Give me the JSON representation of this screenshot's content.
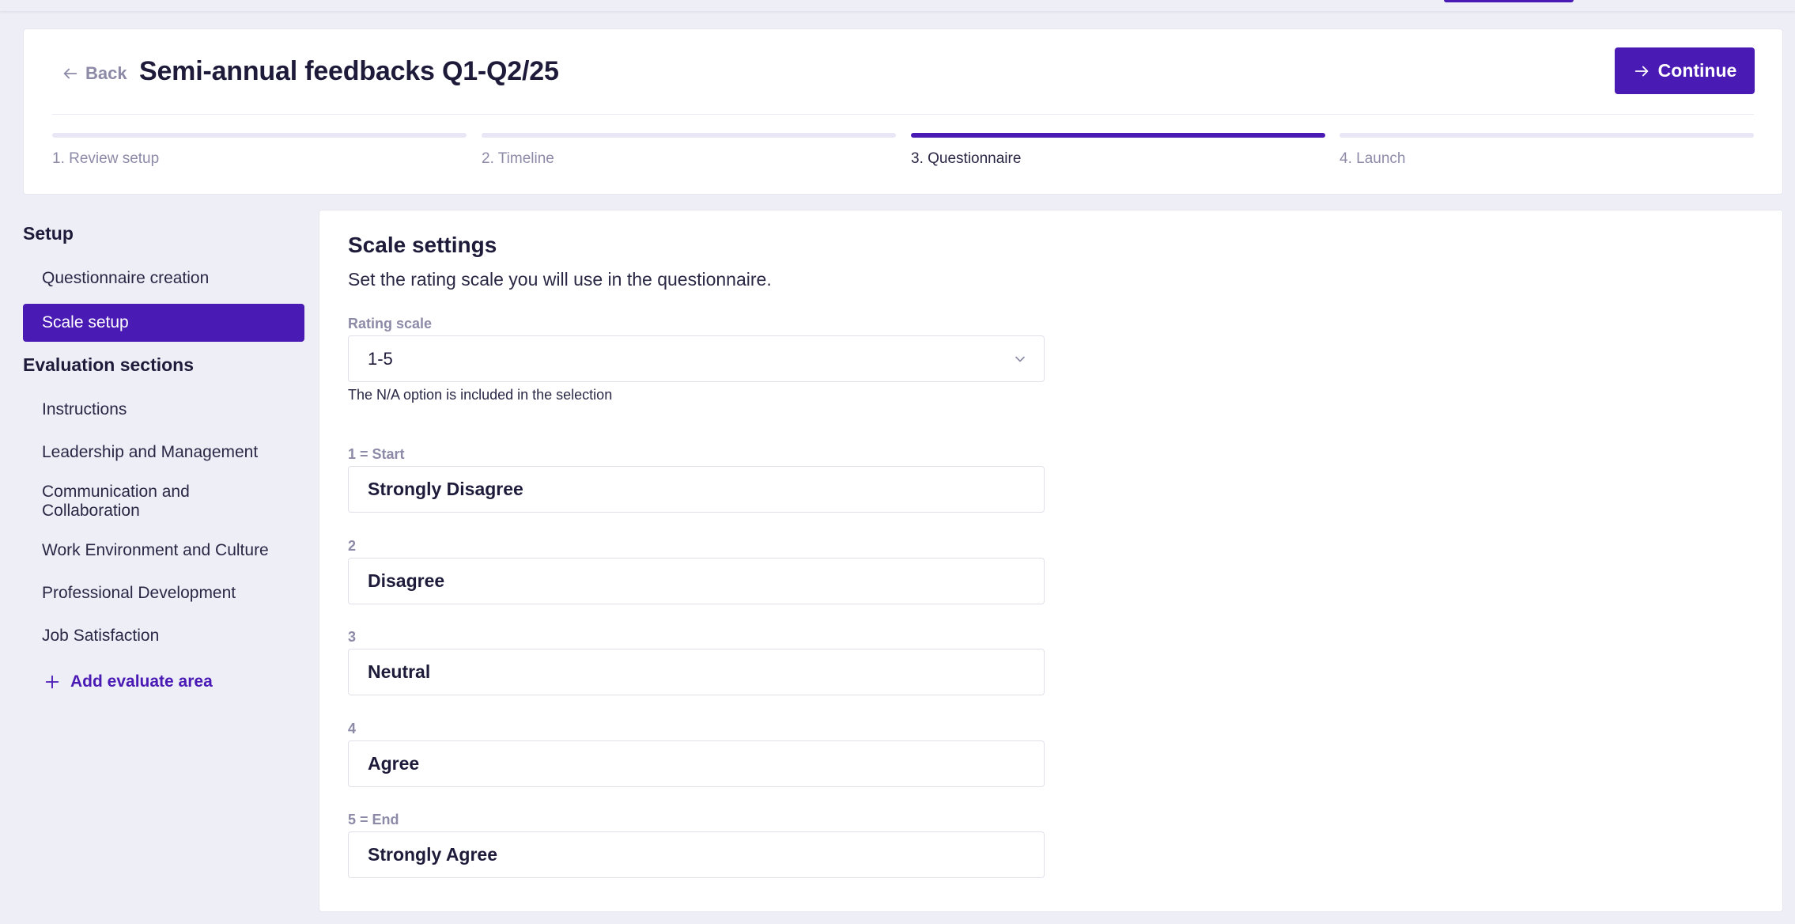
{
  "header": {
    "back_label": "Back",
    "title": "Semi-annual feedbacks Q1-Q2/25",
    "continue_label": "Continue"
  },
  "steps": [
    {
      "label": "1. Review setup",
      "active": false
    },
    {
      "label": "2. Timeline",
      "active": false
    },
    {
      "label": "3. Questionnaire",
      "active": true
    },
    {
      "label": "4. Launch",
      "active": false
    }
  ],
  "sidebar": {
    "setup_heading": "Setup",
    "setup_items": [
      {
        "label": "Questionnaire creation",
        "active": false
      },
      {
        "label": "Scale setup",
        "active": true
      }
    ],
    "evaluation_heading": "Evaluation sections",
    "evaluation_items": [
      {
        "label": "Instructions"
      },
      {
        "label": "Leadership and Management"
      },
      {
        "label": "Communication and Collaboration"
      },
      {
        "label": "Work Environment and Culture"
      },
      {
        "label": "Professional Development"
      },
      {
        "label": "Job Satisfaction"
      }
    ],
    "add_label": "Add evaluate area"
  },
  "main": {
    "title": "Scale settings",
    "description": "Set the rating scale you will use in the questionnaire.",
    "rating_label": "Rating scale",
    "rating_value": "1-5",
    "helper_text": "The N/A option is included in the selection",
    "scale_items": [
      {
        "label": "1 = Start",
        "value": "Strongly Disagree"
      },
      {
        "label": "2",
        "value": "Disagree"
      },
      {
        "label": "3",
        "value": "Neutral"
      },
      {
        "label": "4",
        "value": "Agree"
      },
      {
        "label": "5 = End",
        "value": "Strongly Agree"
      }
    ]
  },
  "colors": {
    "accent": "#4a1ab5",
    "background": "#eeeef7",
    "muted_text": "#8d8aa8"
  },
  "icons": {
    "back": "arrow-left-icon",
    "continue": "arrow-right-icon",
    "select": "chevron-down-icon",
    "add": "plus-icon"
  }
}
